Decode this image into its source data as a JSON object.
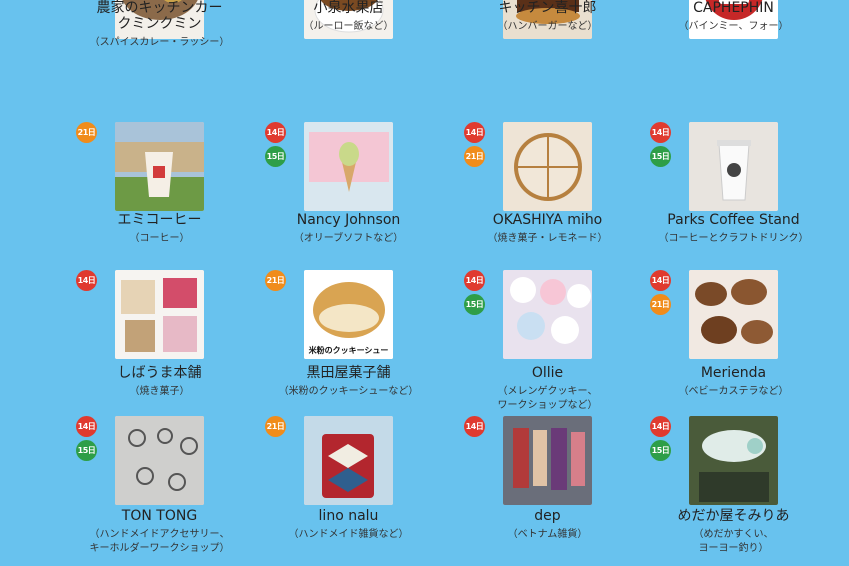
{
  "badge_colors": {
    "14": "#e03a2f",
    "15": "#2e9e48",
    "21": "#f08c1b"
  },
  "background_color": "#68c2ee",
  "vendors": [
    {
      "name_lines": [
        "農家のキッチンカー",
        "クミンクミン"
      ],
      "desc_lines": [
        "（スパイスカレー・ラッシー）"
      ],
      "badges": [],
      "photo": "curry-plate-photo"
    },
    {
      "name_lines": [
        "小泉水果店"
      ],
      "desc_lines": [
        "（ルーロー飯など）"
      ],
      "badges": [],
      "photo": "rice-bowl-photo"
    },
    {
      "name_lines": [
        "キッチン喜十郎"
      ],
      "desc_lines": [
        "（ハンバーガーなど）"
      ],
      "badges": [],
      "photo": "burger-photo"
    },
    {
      "name_lines": [
        "CAPHEPHIN"
      ],
      "desc_lines": [
        "（バインミー、フォー）"
      ],
      "badges": [],
      "photo": "caphephin-logo",
      "logo_text": "CAPHEPHIN"
    },
    {
      "name_lines": [
        "エミコーヒー"
      ],
      "desc_lines": [
        "（コーヒー）"
      ],
      "badges": [
        "21日"
      ],
      "photo": "coffee-cup-photo"
    },
    {
      "name_lines": [
        "Nancy Johnson"
      ],
      "desc_lines": [
        "（オリーブソフトなど）"
      ],
      "badges": [
        "14日",
        "15日"
      ],
      "photo": "soft-serve-truck-photo"
    },
    {
      "name_lines": [
        "OKASHIYA miho"
      ],
      "desc_lines": [
        "（焼き菓子・レモネード）"
      ],
      "badges": [
        "14日",
        "21日"
      ],
      "photo": "cake-photo"
    },
    {
      "name_lines": [
        "Parks Coffee Stand"
      ],
      "desc_lines": [
        "（コーヒーとクラフトドリンク）"
      ],
      "badges": [
        "14日",
        "15日"
      ],
      "photo": "takeaway-cup-photo"
    },
    {
      "name_lines": [
        "しばうま本舗"
      ],
      "desc_lines": [
        "（焼き菓子）"
      ],
      "badges": [
        "14日"
      ],
      "photo": "baked-goods-photo"
    },
    {
      "name_lines": [
        "黒田屋菓子舗"
      ],
      "desc_lines": [
        "（米粉のクッキーシューなど）"
      ],
      "badges": [
        "21日"
      ],
      "photo": "cream-puff-photo",
      "caption": "米粉のクッキーシュー"
    },
    {
      "name_lines": [
        "Ollie"
      ],
      "desc_lines": [
        "（メレンゲクッキー、",
        "ワークショップなど）"
      ],
      "badges": [
        "14日",
        "15日"
      ],
      "photo": "meringue-cookies-photo"
    },
    {
      "name_lines": [
        "Merienda"
      ],
      "desc_lines": [
        "（ベビーカステラなど）"
      ],
      "badges": [
        "14日",
        "21日"
      ],
      "photo": "baby-castella-photo"
    },
    {
      "name_lines": [
        "TON TONG"
      ],
      "desc_lines": [
        "（ハンドメイドアクセサリー、",
        "キーホルダーワークショップ）"
      ],
      "badges": [
        "14日",
        "15日"
      ],
      "photo": "silver-rings-photo"
    },
    {
      "name_lines": [
        "lino nalu"
      ],
      "desc_lines": [
        "（ハンドメイド雑貨など）"
      ],
      "badges": [
        "21日"
      ],
      "photo": "bag-photo"
    },
    {
      "name_lines": [
        "dep"
      ],
      "desc_lines": [
        "（ベトナム雑貨）"
      ],
      "badges": [
        "14日"
      ],
      "photo": "vietnam-goods-photo"
    },
    {
      "name_lines": [
        "めだか屋そみりあ"
      ],
      "desc_lines": [
        "（めだかすくい、",
        "ヨーヨー釣り）"
      ],
      "badges": [
        "14日",
        "15日"
      ],
      "photo": "medaka-scooping-photo"
    }
  ]
}
